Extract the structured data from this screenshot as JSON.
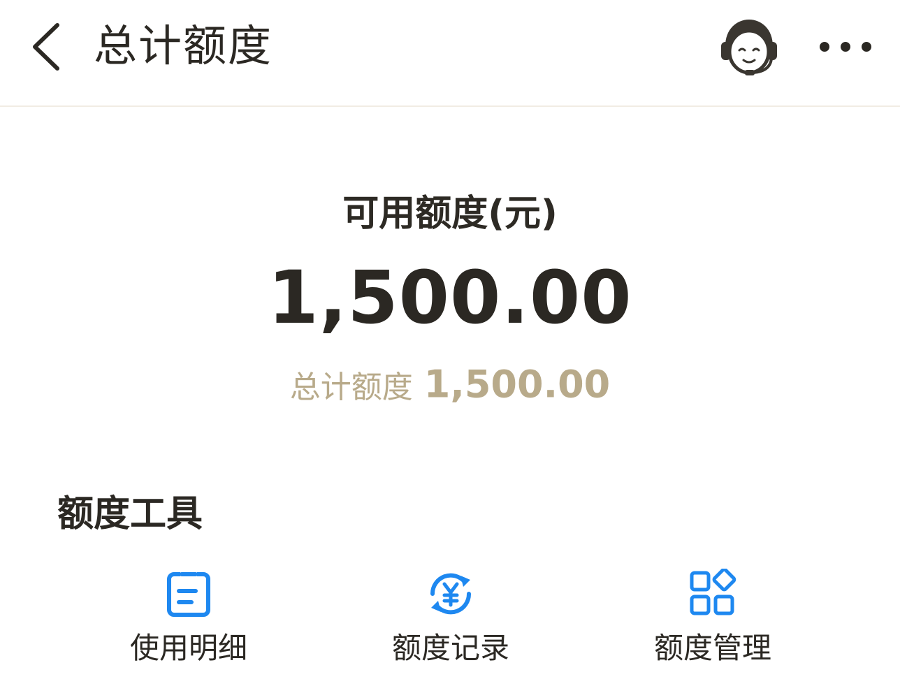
{
  "header": {
    "title": "总计额度",
    "back_icon": "chevron-left-icon",
    "service_icon": "customer-service-icon",
    "more_icon": "more-horizontal-icon"
  },
  "quota": {
    "available_label": "可用额度(元)",
    "available_amount": "1,500.00",
    "total_label": "总计额度",
    "total_amount": "1,500.00"
  },
  "tools": {
    "title": "额度工具",
    "items": [
      {
        "label": "使用明细",
        "icon": "clipboard-list-icon"
      },
      {
        "label": "额度记录",
        "icon": "yen-refresh-icon"
      },
      {
        "label": "额度管理",
        "icon": "apps-grid-icon"
      }
    ]
  },
  "colors": {
    "text_primary": "#2b2823",
    "text_muted": "#b8aa8a",
    "accent_blue": "#1e88f0",
    "divider": "#f1ece4"
  }
}
